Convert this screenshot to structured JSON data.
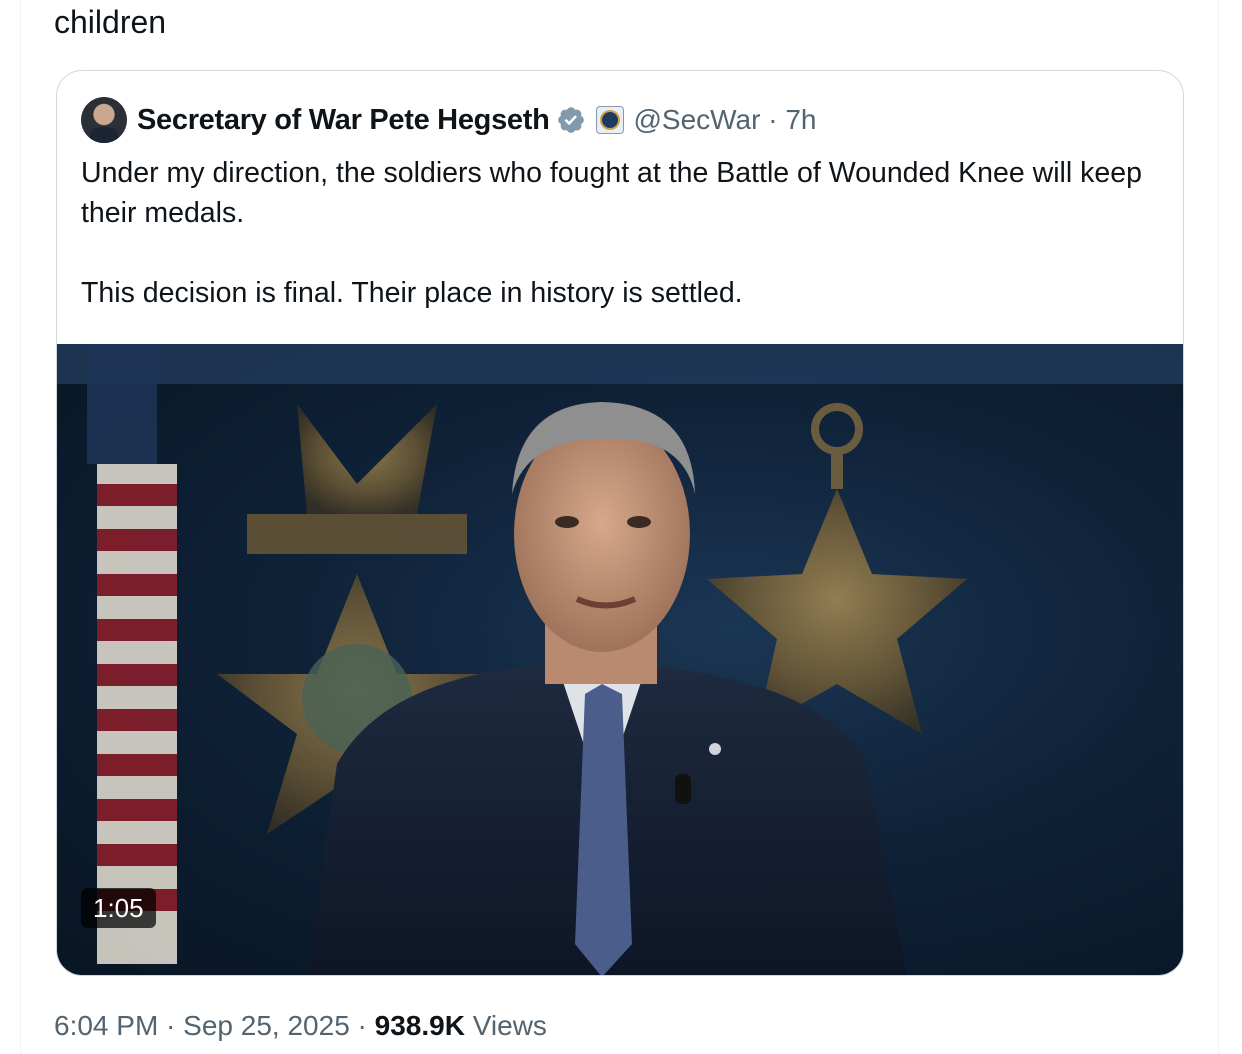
{
  "parent_tweet": {
    "text_fragment": "children",
    "time": "6:04 PM",
    "sep1": " · ",
    "date": "Sep 25, 2025",
    "sep2": " · ",
    "views_count": "938.9K",
    "views_label": " Views"
  },
  "quoted_tweet": {
    "author_name": "Secretary of War Pete Hegseth",
    "handle": "@SecWar",
    "separator": " · ",
    "time_ago": "7h",
    "paragraph_1": "Under my direction, the soldiers who fought at the Battle of Wounded Knee will keep their medals.",
    "paragraph_2": "This decision is final. Their place in history is settled.",
    "media": {
      "type": "video",
      "duration": "1:05"
    },
    "icons": {
      "avatar": "profile-photo",
      "verified": "verified-badge-icon",
      "affiliation": "government-seal-icon"
    }
  },
  "colors": {
    "text_primary": "#0f1419",
    "text_secondary": "#536471",
    "border": "#cfd9de",
    "verified_badge": "#829aab"
  }
}
